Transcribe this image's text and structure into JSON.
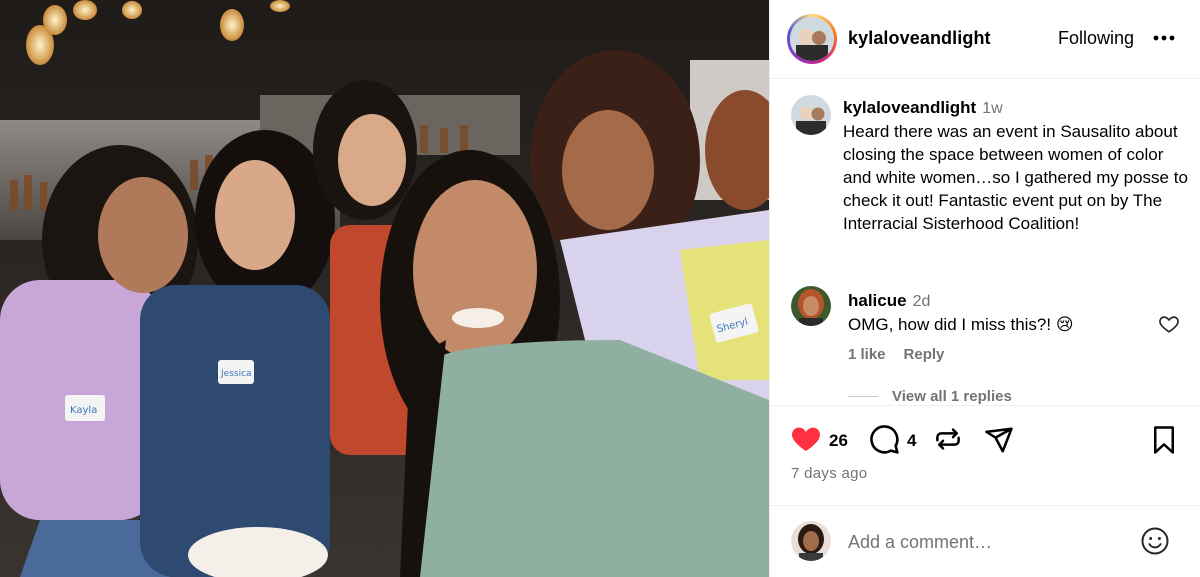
{
  "post": {
    "author": "kylaloveandlight",
    "follow_state": "Following",
    "more_icon": "more-horizontal-icon"
  },
  "caption": {
    "username": "kylaloveandlight",
    "time": "1w",
    "text": "Heard there was an event in Sausalito about closing the space between women of color and white women…so I gathered my posse to check it out! Fantastic event put on by The Interracial Sisterhood Coalition!"
  },
  "comments": [
    {
      "username": "halicue",
      "time": "2d",
      "text": "OMG, how did I miss this?! 😢",
      "likes": "1 like",
      "reply_label": "Reply"
    }
  ],
  "view_replies": "View all 1 replies",
  "actions": {
    "like_count": "26",
    "comment_count": "4",
    "liked": true,
    "like_color": "#ff3040"
  },
  "posted": "7 days ago",
  "add_comment": {
    "placeholder": "Add a comment…"
  },
  "name_tags": {
    "tag1": "Kayla",
    "tag2": "Jessica",
    "tag3": "Sheryl"
  }
}
